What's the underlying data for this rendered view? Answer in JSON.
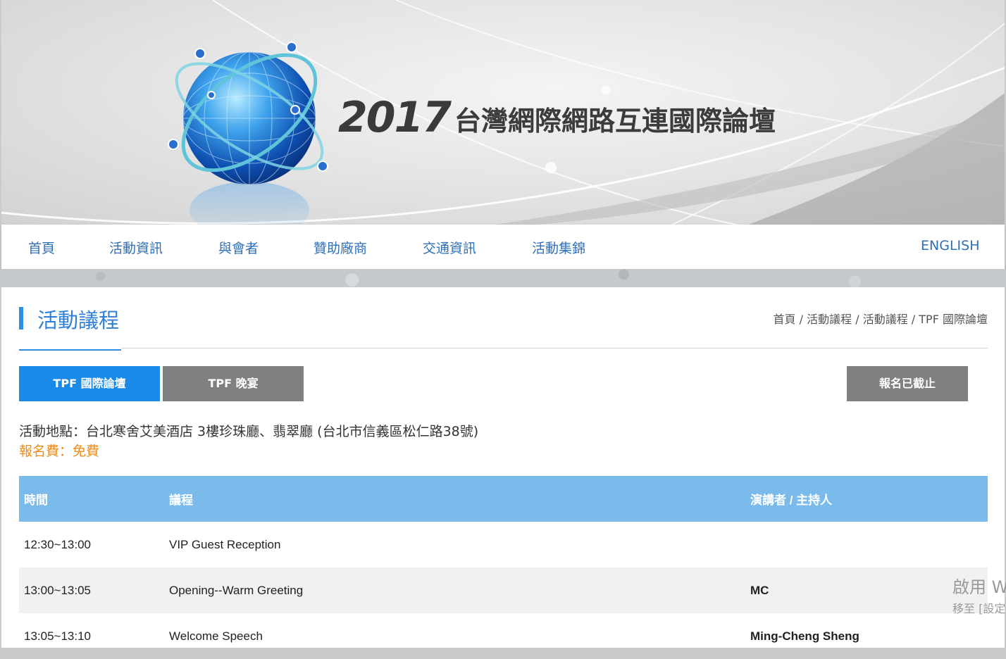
{
  "banner": {
    "year": "2017",
    "title": "台灣網際網路互連國際論壇"
  },
  "nav": {
    "items": [
      "首頁",
      "活動資訊",
      "與會者",
      "贊助廠商",
      "交通資訊",
      "活動集錦"
    ],
    "language": "ENGLISH"
  },
  "page": {
    "title": "活動議程",
    "breadcrumb": [
      "首頁",
      "活動議程",
      "活動議程",
      "TPF 國際論壇"
    ],
    "breadcrumb_sep": " / "
  },
  "tabs": {
    "forum": "TPF 國際論壇",
    "banquet": "TPF 晚宴",
    "registration": "報名已截止"
  },
  "event": {
    "venue": "活動地點：台北寒舍艾美酒店 3樓珍珠廳、翡翠廳 (台北市信義區松仁路38號)",
    "fee": "報名費：免費"
  },
  "schedule": {
    "headers": [
      "時間",
      "議程",
      "演講者 / 主持人"
    ],
    "rows": [
      {
        "time": "12:30~13:00",
        "agenda": "VIP Guest Reception",
        "speaker": ""
      },
      {
        "time": "13:00~13:05",
        "agenda": "Opening--Warm Greeting",
        "speaker": "MC"
      },
      {
        "time": "13:05~13:10",
        "agenda": "Welcome Speech",
        "speaker": "Ming-Cheng Sheng"
      }
    ]
  },
  "watermark": {
    "line1": "啟用 W",
    "line2": "移至 [設定"
  },
  "colors": {
    "accent": "#1a8ae9",
    "nav_text": "#2f6fb7",
    "fee": "#f08a14",
    "table_header": "#7bbbeb",
    "tab_gray": "#808080"
  }
}
